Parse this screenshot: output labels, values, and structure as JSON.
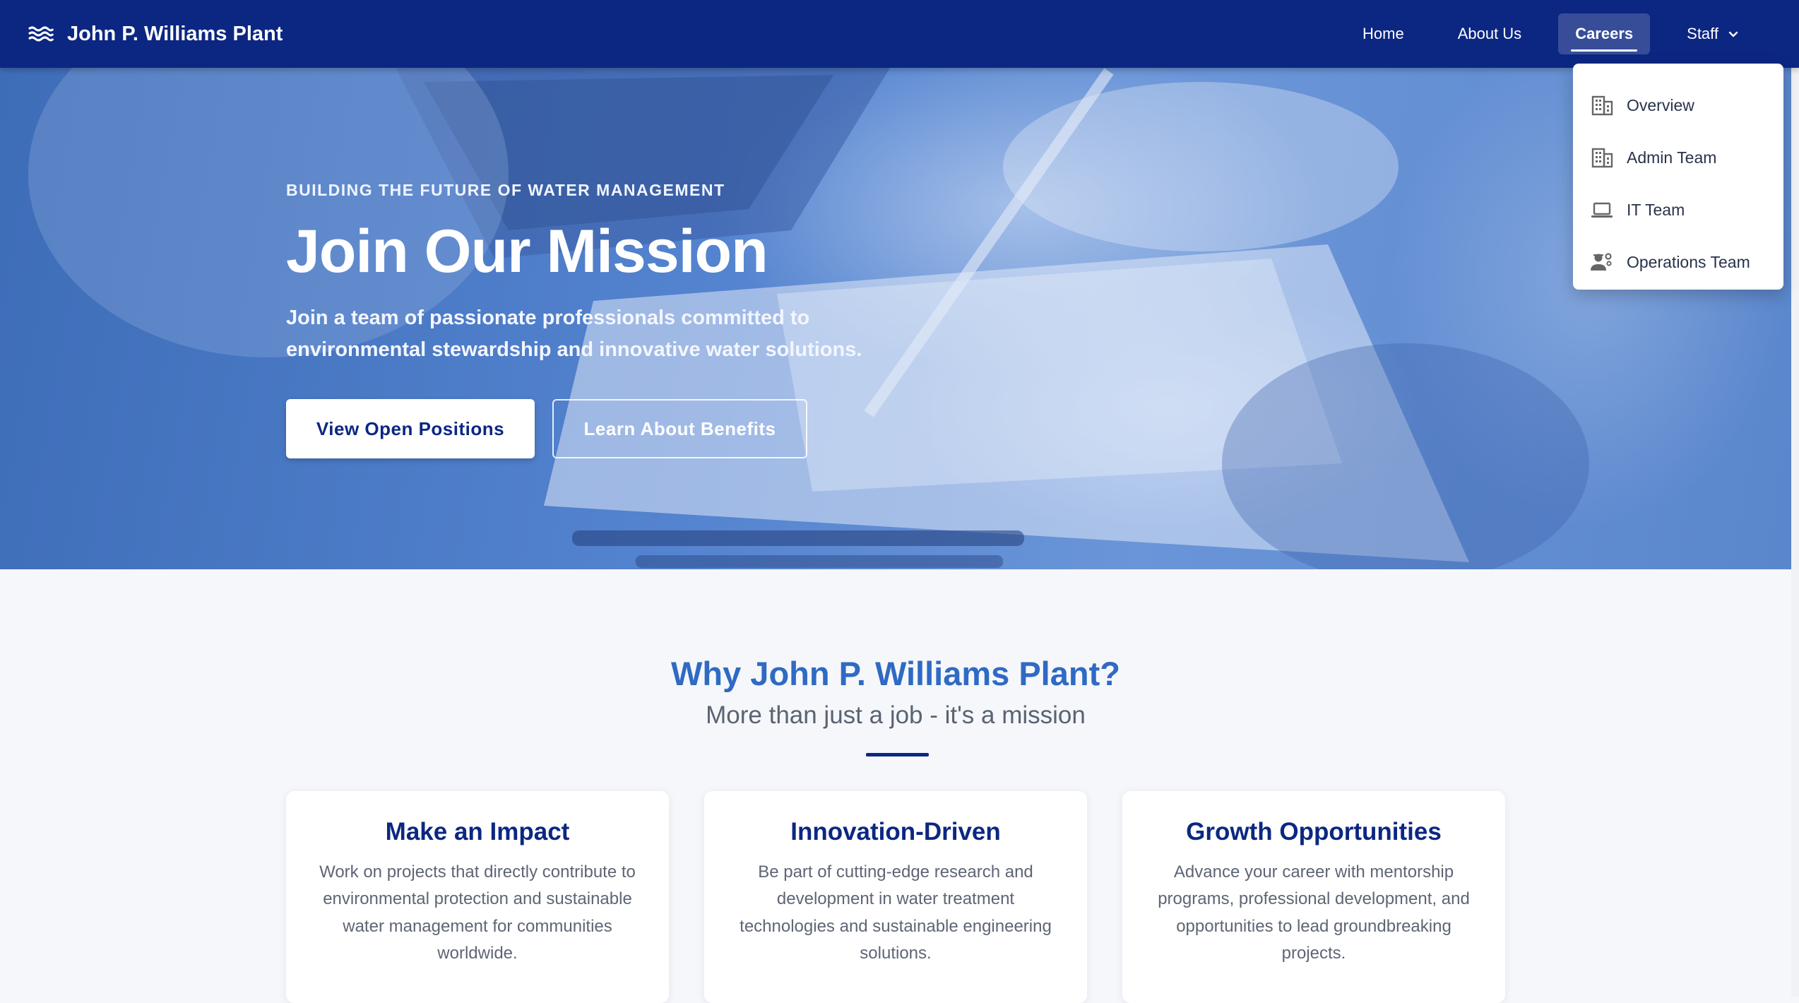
{
  "brand": {
    "name": "John P. Williams Plant",
    "icon": "waves-icon"
  },
  "nav": {
    "items": [
      {
        "label": "Home"
      },
      {
        "label": "About Us"
      },
      {
        "label": "Careers",
        "active": true
      },
      {
        "label": "Staff",
        "icon": "chevron-down-icon"
      }
    ]
  },
  "staff_menu": {
    "items": [
      {
        "label": "Overview",
        "icon": "building-icon"
      },
      {
        "label": "Admin Team",
        "icon": "building-icon"
      },
      {
        "label": "IT Team",
        "icon": "laptop-icon"
      },
      {
        "label": "Operations Team",
        "icon": "engineering-icon"
      }
    ]
  },
  "hero": {
    "kicker": "BUILDING THE FUTURE OF WATER MANAGEMENT",
    "title": "Join Our Mission",
    "subtitle": "Join a team of passionate professionals committed to environmental stewardship and innovative water solutions.",
    "primary_button": "View Open Positions",
    "secondary_button": "Learn About Benefits"
  },
  "why": {
    "title": "Why John P. Williams Plant?",
    "subtitle": "More than just a job - it's a mission",
    "cards": [
      {
        "title": "Make an Impact",
        "text": "Work on projects that directly contribute to environmental protection and sustainable water management for communities worldwide."
      },
      {
        "title": "Innovation-Driven",
        "text": "Be part of cutting-edge research and development in water treatment technologies and sustainable engineering solutions."
      },
      {
        "title": "Growth Opportunities",
        "text": "Advance your career with mentorship programs, professional development, and opportunities to lead groundbreaking projects."
      }
    ]
  },
  "colors": {
    "navbar": "#0c2782",
    "accent": "#2f6ac3",
    "hero_overlay": "#4f7fcc",
    "page_background": "#f5f7fa"
  }
}
